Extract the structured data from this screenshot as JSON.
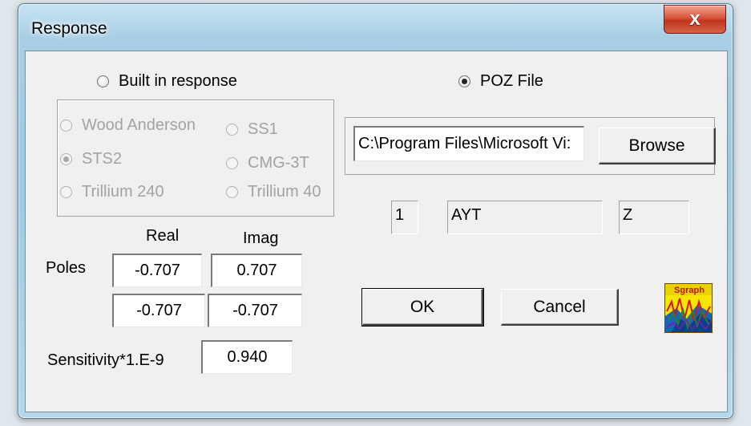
{
  "window": {
    "title": "Response",
    "close_glyph": "x"
  },
  "source": {
    "builtin_label": "Built in response",
    "builtin_checked": false,
    "poz_label": "POZ File",
    "poz_checked": true
  },
  "builtin_options": [
    {
      "label": "Wood Anderson",
      "checked": false
    },
    {
      "label": "SS1",
      "checked": false
    },
    {
      "label": "STS2",
      "checked": true
    },
    {
      "label": "CMG-3T",
      "checked": false
    },
    {
      "label": "Trillium 240",
      "checked": false
    },
    {
      "label": "Trillium 40",
      "checked": false
    }
  ],
  "poz": {
    "path_value": "C:\\Program Files\\Microsoft Vi:",
    "browse_label": "Browse"
  },
  "station_info": {
    "index": "1",
    "station": "AYT",
    "component": "Z"
  },
  "poles": {
    "label": "Poles",
    "real_header": "Real",
    "imag_header": "Imag",
    "rows": [
      {
        "real": "-0.707",
        "imag": "0.707"
      },
      {
        "real": "-0.707",
        "imag": "-0.707"
      }
    ]
  },
  "sensitivity": {
    "label": "Sensitivity*1.E-9",
    "value": "0.940"
  },
  "buttons": {
    "ok": "OK",
    "cancel": "Cancel"
  },
  "logo": {
    "text": "Sgraph",
    "icon": "sgraph-logo"
  },
  "colors": {
    "title_gradient": "#9ccae1",
    "close_button": "#c0331c",
    "client_background": "#f0f0f0",
    "disabled_text": "#a3a3a3"
  }
}
